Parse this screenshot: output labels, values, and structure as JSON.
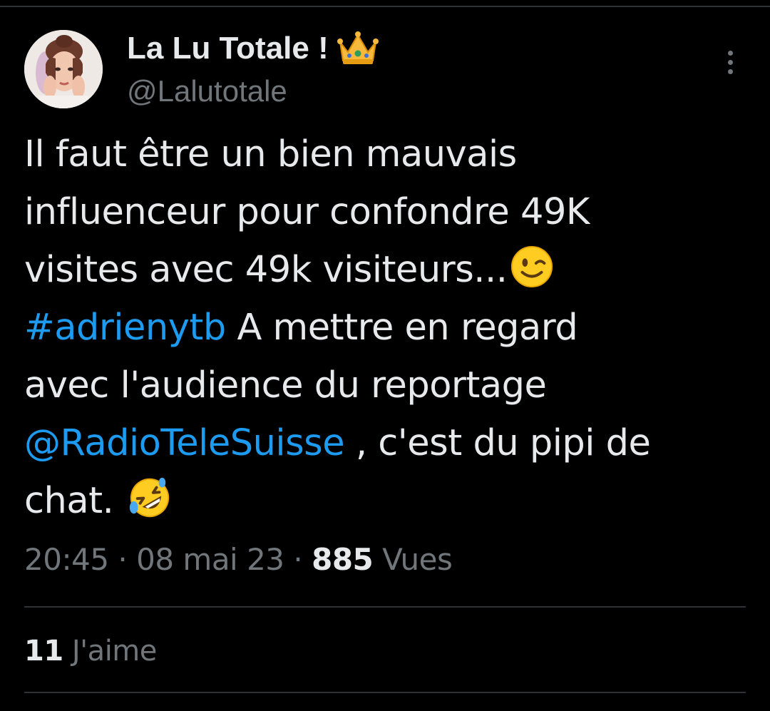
{
  "author": {
    "display_name": "La Lu Totale !",
    "badge_emoji": "crown-emoji",
    "handle": "@Lalutotale"
  },
  "tweet": {
    "lines": [
      [
        {
          "text": "Il faut être un bien mauvais",
          "type": "text"
        }
      ],
      [
        {
          "text": "influenceur pour confondre 49K",
          "type": "text"
        }
      ],
      [
        {
          "text": "visites avec 49k visiteurs...",
          "type": "text"
        },
        {
          "emoji": "winking-face-emoji"
        }
      ],
      [
        {
          "text": "#adrienytb",
          "type": "link"
        },
        {
          "text": " A mettre en regard",
          "type": "text"
        }
      ],
      [
        {
          "text": "avec l'audience du reportage",
          "type": "text"
        }
      ],
      [
        {
          "text": "@RadioTeleSuisse",
          "type": "link"
        },
        {
          "text": " , c'est du pipi de",
          "type": "text"
        }
      ],
      [
        {
          "text": "chat. ",
          "type": "text"
        },
        {
          "emoji": "rolling-on-floor-laughing-emoji"
        }
      ]
    ]
  },
  "meta": {
    "time": "20:45",
    "separator": " · ",
    "date": "08 mai 23",
    "views_count": "885",
    "views_label": " Vues"
  },
  "stats": {
    "likes_count": "11",
    "likes_label": " J'aime"
  },
  "colors": {
    "background": "#000000",
    "text": "#e7e9ea",
    "secondary": "#71767b",
    "link": "#1d9bf0",
    "divider": "#2f3336"
  }
}
